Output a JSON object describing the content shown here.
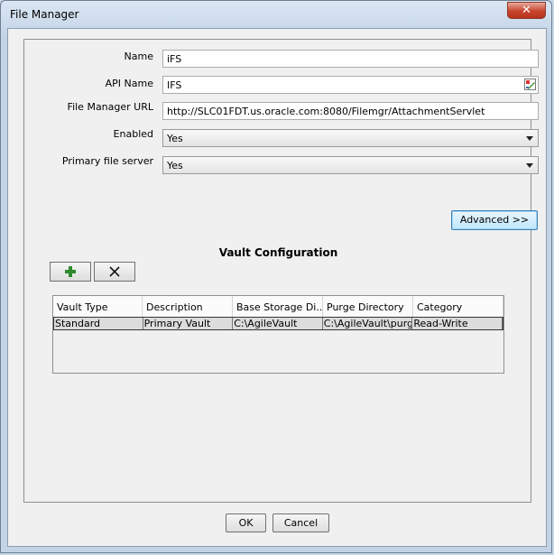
{
  "window": {
    "title": "File Manager",
    "close_glyph": "✕"
  },
  "form": {
    "name": {
      "label": "Name",
      "value": "iFS"
    },
    "api_name": {
      "label": "API Name",
      "value": "IFS"
    },
    "url": {
      "label": "File Manager URL",
      "value": "http://SLC01FDT.us.oracle.com:8080/Filemgr/AttachmentServlet"
    },
    "enabled": {
      "label": "Enabled",
      "value": "Yes"
    },
    "primary": {
      "label": "Primary file server",
      "value": "Yes"
    },
    "advanced_label": "Advanced >>"
  },
  "vault": {
    "title": "Vault Configuration",
    "add_icon": "plus-icon",
    "remove_icon": "x-icon",
    "columns": [
      "Vault Type",
      "Description",
      "Base Storage Di...",
      "Purge Directory",
      "Category"
    ],
    "rows": [
      [
        "Standard",
        "Primary Vault",
        "C:\\AgileVault",
        "C:\\AgileVault\\purge",
        "Read-Write"
      ]
    ]
  },
  "footer": {
    "ok_label": "OK",
    "cancel_label": "Cancel"
  },
  "colors": {
    "add_icon": "#2e8b2e",
    "accent": "#3c7fb1"
  }
}
